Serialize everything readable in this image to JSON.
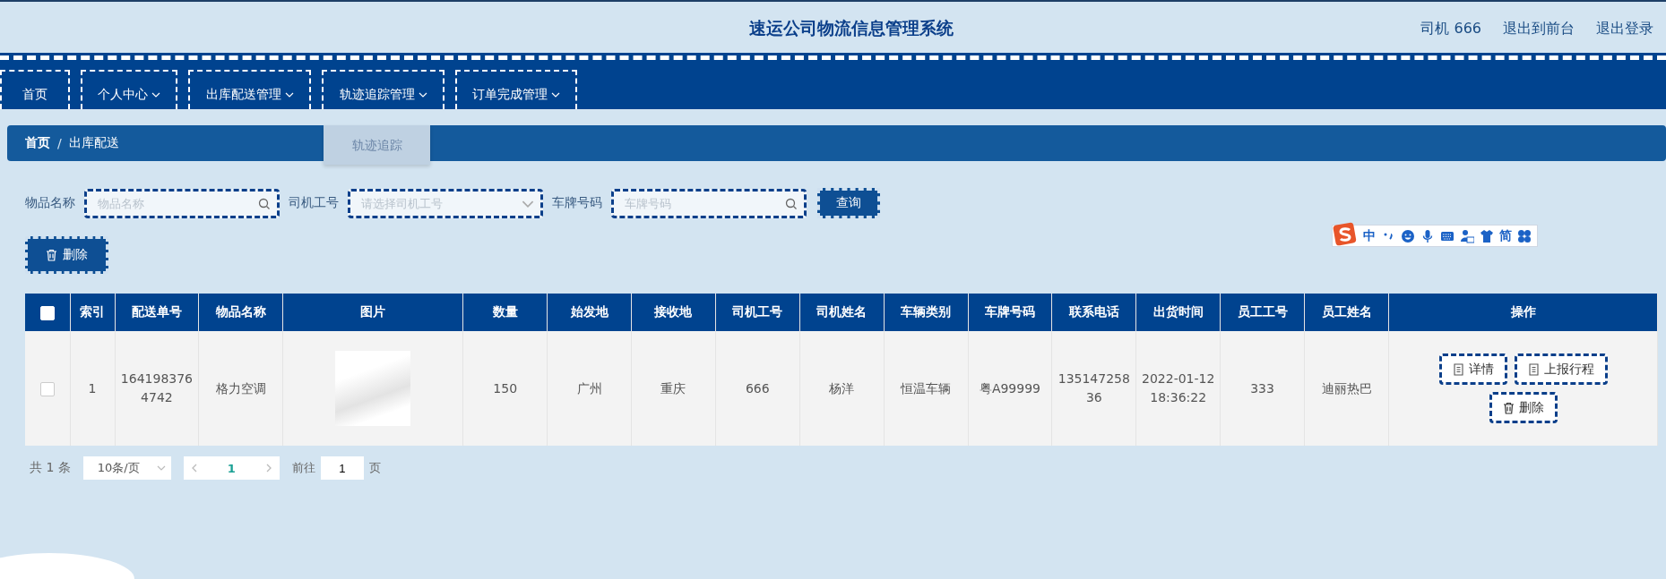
{
  "header": {
    "title": "速运公司物流信息管理系统",
    "links": [
      "司机 666",
      "退出到前台",
      "退出登录"
    ]
  },
  "nav": {
    "items": [
      {
        "label": "首页",
        "dropdown": false
      },
      {
        "label": "个人中心",
        "dropdown": true
      },
      {
        "label": "出库配送管理",
        "dropdown": true
      },
      {
        "label": "轨迹追踪管理",
        "dropdown": true,
        "submenu": [
          "轨迹追踪"
        ]
      },
      {
        "label": "订单完成管理",
        "dropdown": true
      }
    ]
  },
  "breadcrumb": {
    "items": [
      "首页",
      "出库配送"
    ],
    "separator": "/"
  },
  "search": {
    "fields": [
      {
        "label": "物品名称",
        "kind": "text",
        "placeholder": "物品名称"
      },
      {
        "label": "司机工号",
        "kind": "select",
        "placeholder": "请选择司机工号"
      },
      {
        "label": "车牌号码",
        "kind": "text",
        "placeholder": "车牌号码"
      }
    ],
    "button": "查询"
  },
  "delete_button": "删除",
  "ime_toolbar": {
    "mode": "中",
    "script": "简"
  },
  "table": {
    "header_checked": false,
    "columns": [
      {
        "kind": "checkbox"
      },
      {
        "label": "索引",
        "kind": "text"
      },
      {
        "label": "配送单号",
        "kind": "text"
      },
      {
        "label": "物品名称",
        "kind": "text"
      },
      {
        "label": "图片",
        "kind": "image"
      },
      {
        "label": "数量",
        "kind": "text"
      },
      {
        "label": "始发地",
        "kind": "text"
      },
      {
        "label": "接收地",
        "kind": "text"
      },
      {
        "label": "司机工号",
        "kind": "text"
      },
      {
        "label": "司机姓名",
        "kind": "text"
      },
      {
        "label": "车辆类别",
        "kind": "text"
      },
      {
        "label": "车牌号码",
        "kind": "text"
      },
      {
        "label": "联系电话",
        "kind": "text"
      },
      {
        "label": "出货时间",
        "kind": "text"
      },
      {
        "label": "员工工号",
        "kind": "text"
      },
      {
        "label": "员工姓名",
        "kind": "text"
      },
      {
        "label": "操作",
        "kind": "actions"
      }
    ],
    "rows": [
      {
        "checked": false,
        "cells": [
          "",
          "1",
          "1641983764742",
          "格力空调",
          "",
          "150",
          "广州",
          "重庆",
          "666",
          "杨洋",
          "恒温车辆",
          "粤A99999",
          "13514725836",
          "2022-01-12 18:36:22",
          "333",
          "迪丽热巴",
          ""
        ],
        "actions": [
          {
            "label": "详情",
            "kind": "view"
          },
          {
            "label": "上报行程",
            "kind": "report"
          },
          {
            "label": "删除",
            "kind": "delete"
          }
        ]
      }
    ]
  },
  "pagination": {
    "total": "共 1 条",
    "page_size": "10条/页",
    "pages": [
      {
        "label": "1",
        "selected": true
      }
    ],
    "goto_label": "前往",
    "goto_value": "1",
    "goto_suffix": "页"
  }
}
